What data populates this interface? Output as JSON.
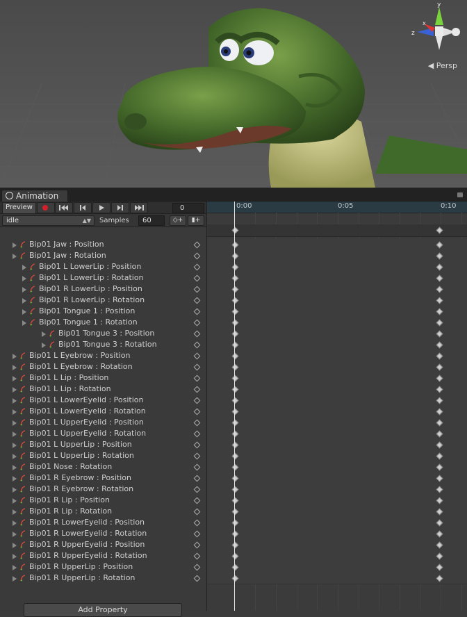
{
  "scene": {
    "view_label": "Persp",
    "axes": {
      "x": "x",
      "y": "y",
      "z": "z"
    }
  },
  "panel": {
    "tab_title": "Animation",
    "toolbar": {
      "preview_label": "Preview",
      "frame_value": "0"
    },
    "clip": {
      "selected": "idle",
      "samples_label": "Samples",
      "samples_value": "60",
      "add_keyframe_icon": "◇+",
      "add_event_icon": "▮+"
    },
    "timeline": {
      "ticks": [
        "0:00",
        "0:05",
        "0:10"
      ]
    },
    "properties": [
      {
        "label": "Bip01 Jaw : Position",
        "indent": 0
      },
      {
        "label": "Bip01 Jaw : Rotation",
        "indent": 0
      },
      {
        "label": "Bip01 L LowerLip : Position",
        "indent": 1
      },
      {
        "label": "Bip01 L LowerLip : Rotation",
        "indent": 1
      },
      {
        "label": "Bip01 R LowerLip : Position",
        "indent": 1
      },
      {
        "label": "Bip01 R LowerLip : Rotation",
        "indent": 1
      },
      {
        "label": "Bip01 Tongue 1 : Position",
        "indent": 1
      },
      {
        "label": "Bip01 Tongue 1 : Rotation",
        "indent": 1
      },
      {
        "label": "Bip01 Tongue 3 : Position",
        "indent": 2
      },
      {
        "label": "Bip01 Tongue 3 : Rotation",
        "indent": 2
      },
      {
        "label": "Bip01 L Eyebrow : Position",
        "indent": 0
      },
      {
        "label": "Bip01 L Eyebrow : Rotation",
        "indent": 0
      },
      {
        "label": "Bip01 L Lip : Position",
        "indent": 0
      },
      {
        "label": "Bip01 L Lip : Rotation",
        "indent": 0
      },
      {
        "label": "Bip01 L LowerEyelid : Position",
        "indent": 0
      },
      {
        "label": "Bip01 L LowerEyelid : Rotation",
        "indent": 0
      },
      {
        "label": "Bip01 L UpperEyelid : Position",
        "indent": 0
      },
      {
        "label": "Bip01 L UpperEyelid : Rotation",
        "indent": 0
      },
      {
        "label": "Bip01 L UpperLip : Position",
        "indent": 0
      },
      {
        "label": "Bip01 L UpperLip : Rotation",
        "indent": 0
      },
      {
        "label": "Bip01 Nose : Rotation",
        "indent": 0
      },
      {
        "label": "Bip01 R Eyebrow : Position",
        "indent": 0
      },
      {
        "label": "Bip01 R Eyebrow : Rotation",
        "indent": 0
      },
      {
        "label": "Bip01 R Lip : Position",
        "indent": 0
      },
      {
        "label": "Bip01 R Lip : Rotation",
        "indent": 0
      },
      {
        "label": "Bip01 R LowerEyelid : Position",
        "indent": 0
      },
      {
        "label": "Bip01 R LowerEyelid : Rotation",
        "indent": 0
      },
      {
        "label": "Bip01 R UpperEyelid : Position",
        "indent": 0
      },
      {
        "label": "Bip01 R UpperEyelid : Rotation",
        "indent": 0
      },
      {
        "label": "Bip01 R UpperLip : Position",
        "indent": 0
      },
      {
        "label": "Bip01 R UpperLip : Rotation",
        "indent": 0
      }
    ],
    "add_property_label": "Add Property"
  }
}
